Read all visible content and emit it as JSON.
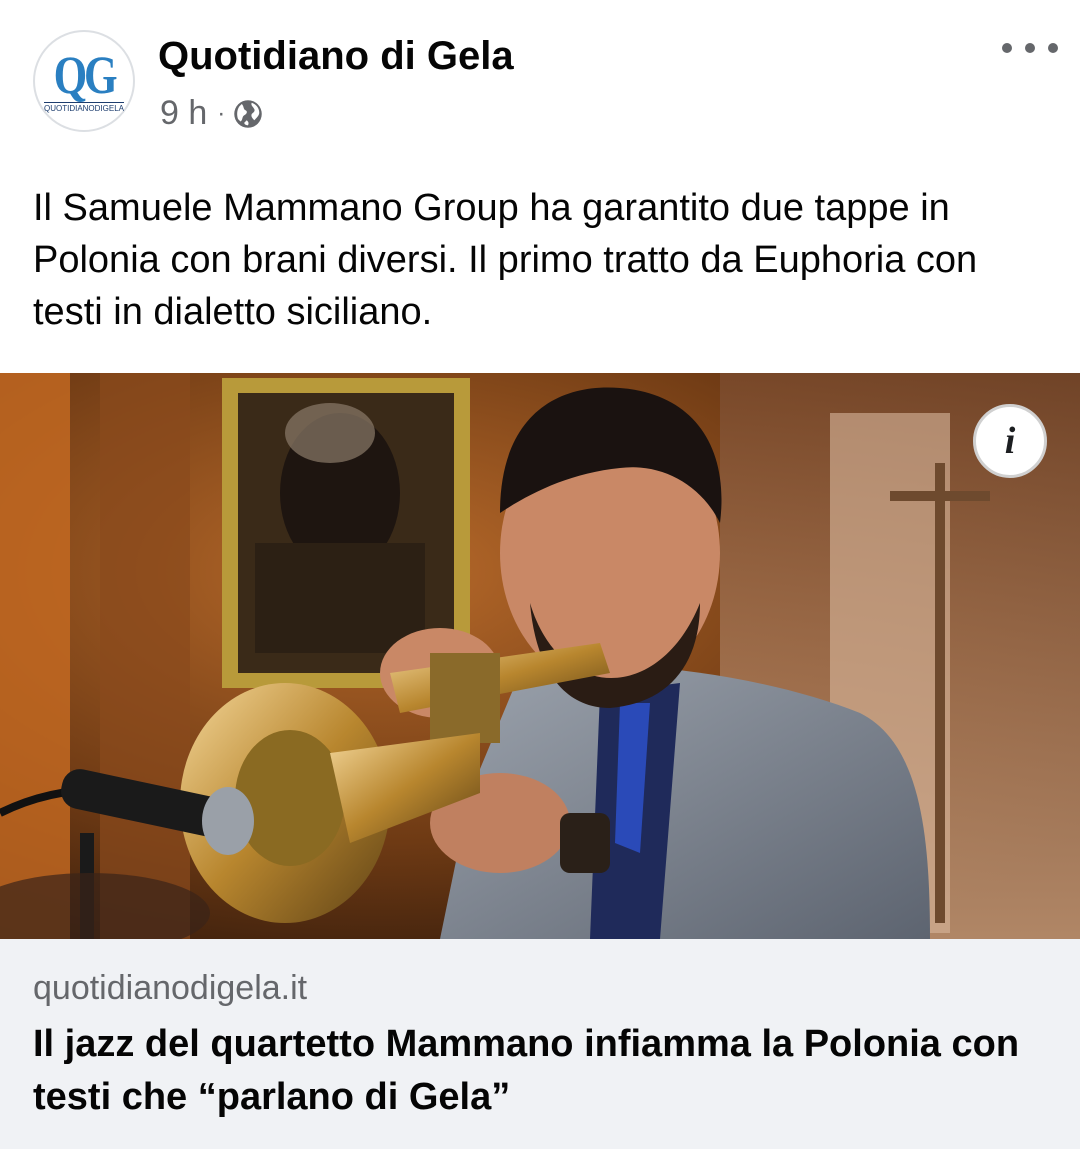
{
  "header": {
    "page_name": "Quotidiano di Gela",
    "timestamp": "9 h",
    "separator": "·",
    "privacy_icon": "globe-icon",
    "avatar_logo": "QG",
    "avatar_logo_sub": "QUOTIDIANODIGELA"
  },
  "post": {
    "text": "Il Samuele Mammano Group ha garantito due tappe in Polonia con brani diversi. Il primo tratto da Euphoria con testi in dialetto siciliano."
  },
  "image": {
    "info_icon": "i"
  },
  "link": {
    "domain": "quotidianodigela.it",
    "title": "Il jazz del quartetto Mammano infiamma la Polonia con testi che “parlano di Gela”"
  },
  "colors": {
    "text_primary": "#050505",
    "text_secondary": "#65676b",
    "link_bg": "#f0f2f5",
    "logo_blue": "#2a7fc1"
  }
}
